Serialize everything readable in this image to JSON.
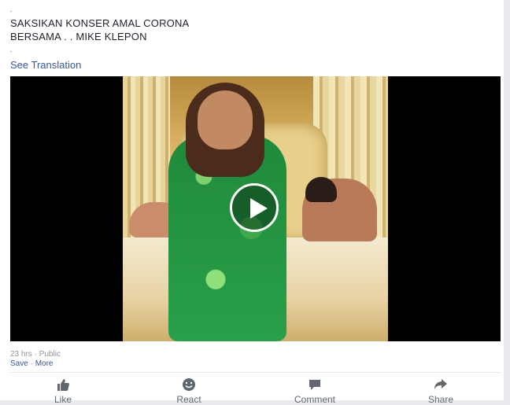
{
  "post": {
    "dot_top": ".",
    "line1": "SAKSIKAN KONSER AMAL CORONA",
    "line2": "BERSAMA . . MIKE KLEPON",
    "dot_bottom": ".",
    "see_translation": "See Translation"
  },
  "video": {
    "play_icon": "play-icon"
  },
  "meta": {
    "time": "23 hrs",
    "sep": " · ",
    "privacy": "Public",
    "save": "Save",
    "more": "More"
  },
  "actions": [
    {
      "label": "Like",
      "icon": "thumbs-up-icon"
    },
    {
      "label": "React",
      "icon": "smiley-icon"
    },
    {
      "label": "Comment",
      "icon": "comment-icon"
    },
    {
      "label": "Share",
      "icon": "share-icon"
    }
  ],
  "colors": {
    "link": "#365899",
    "text": "#1d2129",
    "muted": "#90949c",
    "action_gray": "#606770"
  }
}
